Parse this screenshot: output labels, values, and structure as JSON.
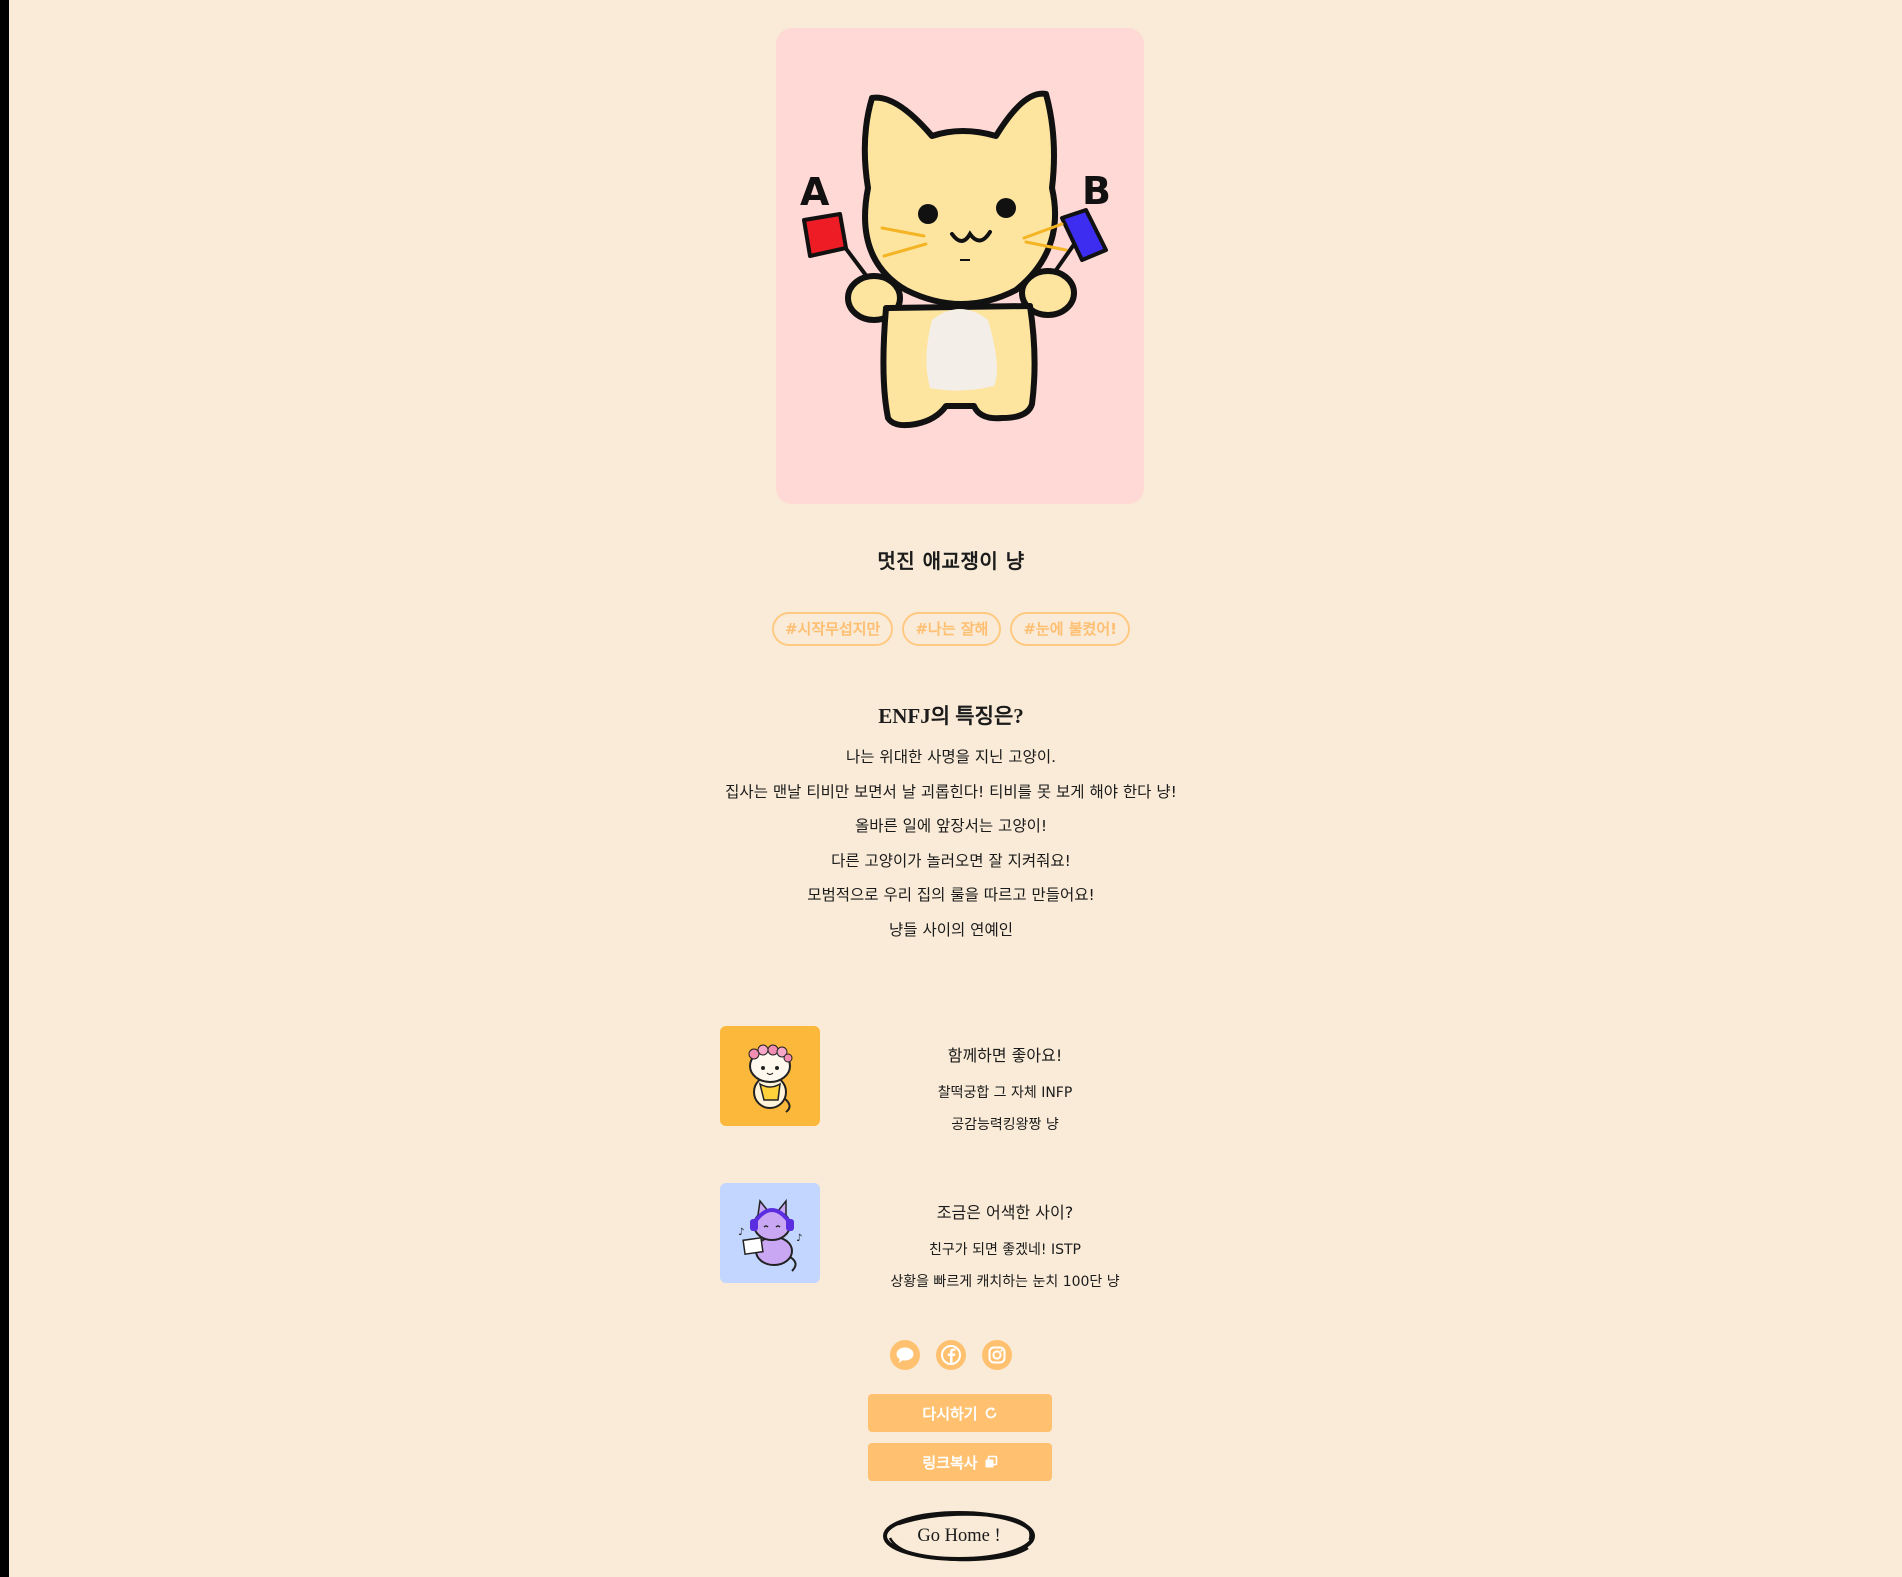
{
  "result": {
    "title": "멋진 애교쟁이 냥",
    "hero_image": "yellow-cat-holding-ab-flags",
    "flag_a_label": "A",
    "flag_b_label": "B",
    "hashtags": [
      "#시작무섭지만",
      "#나는 잘해",
      "#눈에 불켰어!"
    ]
  },
  "features": {
    "heading": "ENFJ의 특징은?",
    "lines": [
      "나는 위대한 사명을 지닌 고양이.",
      "집사는 맨날 티비만 보면서 날 괴롭힌다! 티비를 못 보게 해야 한다 냥!",
      "올바른 일에 앞장서는 고양이!",
      "다른 고양이가 놀러오면 잘 지켜줘요!",
      "모범적으로 우리 집의 룰을 따르고 만들어요!",
      "냥들 사이의 연예인"
    ]
  },
  "matches": [
    {
      "heading": "함께하면 좋아요!",
      "line1": "찰떡궁합 그 자체 INFP",
      "line2": "공감능력킹왕짱 냥",
      "image": "flower-crown-cat-thumbnail",
      "bg_color": "#fbb83a"
    },
    {
      "heading": "조금은 어색한 사이?",
      "line1": "친구가 되면 좋겠네! ISTP",
      "line2": "상황을 빠르게 캐치하는 눈치 100단 냥",
      "image": "headphone-cat-thumbnail",
      "bg_color": "#c2d6ff"
    }
  ],
  "share": {
    "icons": [
      "kakaotalk-icon",
      "facebook-icon",
      "instagram-icon"
    ],
    "color": "#ffc170"
  },
  "buttons": {
    "retry_label": "다시하기",
    "copy_link_label": "링크복사",
    "home_label": "Go Home !"
  },
  "colors": {
    "background": "#f9ebd7",
    "card": "#ffd9d6",
    "accent": "#ffc170"
  }
}
